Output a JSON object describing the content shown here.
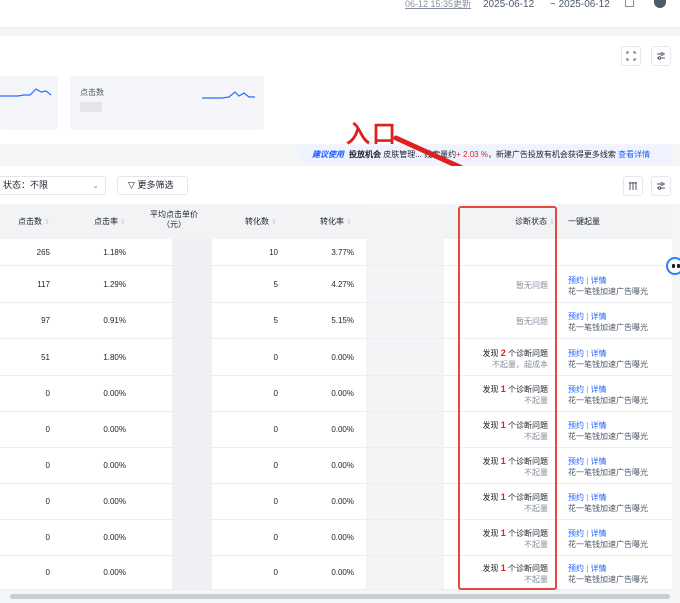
{
  "header": {
    "updated_text": "06-12 15:35更新",
    "start_date": "2025-06-12",
    "end_date": "~ 2025-06-12"
  },
  "overview": {
    "cards": [
      {
        "label": ""
      },
      {
        "label": "点击数"
      }
    ]
  },
  "annotation": {
    "text": "入口",
    "color": "#e02020"
  },
  "notice": {
    "tag": "建议使用",
    "prefix": "投放机会",
    "text": "皮肤管理... 线索量约",
    "change": "+ 2.03 %",
    "suffix": "，新建广告投放有机会获得更多线索",
    "link": "查看详情"
  },
  "filters": {
    "status_label": "状态：",
    "status_value": "不限",
    "more_label": "更多筛选"
  },
  "table": {
    "columns": {
      "clicks": "点击数",
      "ctr": "点击率",
      "cpc_line1": "平均点击单价",
      "cpc_line2": "（元）",
      "conversions": "转化数",
      "cvr": "转化率",
      "diagnosis": "诊断状态",
      "boost": "一键起量"
    },
    "rows": [
      {
        "clicks": "265",
        "ctr": "1.18%",
        "conv": "10",
        "cvr": "3.77%",
        "diag_line1": "",
        "diag_line2": "",
        "diag_num": "",
        "link1": "",
        "sep": "",
        "link2": "",
        "sub": ""
      },
      {
        "clicks": "117",
        "ctr": "1.29%",
        "conv": "5",
        "cvr": "4.27%",
        "diag_line1": "暂无问题",
        "diag_line2": "",
        "diag_num": "",
        "link1": "预约",
        "sep": "|",
        "link2": "详情",
        "sub": "花一笔钱加速广告曝光"
      },
      {
        "clicks": "97",
        "ctr": "0.91%",
        "conv": "5",
        "cvr": "5.15%",
        "diag_line1": "暂无问题",
        "diag_line2": "",
        "diag_num": "",
        "link1": "预约",
        "sep": "|",
        "link2": "详情",
        "sub": "花一笔钱加速广告曝光"
      },
      {
        "clicks": "51",
        "ctr": "1.80%",
        "conv": "0",
        "cvr": "0.00%",
        "diag_line1": "个诊断问题",
        "diag_line2": "不起量，超成本",
        "diag_num": "2",
        "link1": "预约",
        "sep": "|",
        "link2": "详情",
        "sub": "花一笔钱加速广告曝光"
      },
      {
        "clicks": "0",
        "ctr": "0.00%",
        "conv": "0",
        "cvr": "0.00%",
        "diag_line1": "个诊断问题",
        "diag_line2": "不起量",
        "diag_num": "1",
        "link1": "预约",
        "sep": "|",
        "link2": "详情",
        "sub": "花一笔钱加速广告曝光"
      },
      {
        "clicks": "0",
        "ctr": "0.00%",
        "conv": "0",
        "cvr": "0.00%",
        "diag_line1": "个诊断问题",
        "diag_line2": "不起量",
        "diag_num": "1",
        "link1": "预约",
        "sep": "|",
        "link2": "详情",
        "sub": "花一笔钱加速广告曝光"
      },
      {
        "clicks": "0",
        "ctr": "0.00%",
        "conv": "0",
        "cvr": "0.00%",
        "diag_line1": "个诊断问题",
        "diag_line2": "不起量",
        "diag_num": "1",
        "link1": "预约",
        "sep": "|",
        "link2": "详情",
        "sub": "花一笔钱加速广告曝光"
      },
      {
        "clicks": "0",
        "ctr": "0.00%",
        "conv": "0",
        "cvr": "0.00%",
        "diag_line1": "个诊断问题",
        "diag_line2": "不起量",
        "diag_num": "1",
        "link1": "预约",
        "sep": "|",
        "link2": "详情",
        "sub": "花一笔钱加速广告曝光"
      },
      {
        "clicks": "0",
        "ctr": "0.00%",
        "conv": "0",
        "cvr": "0.00%",
        "diag_line1": "个诊断问题",
        "diag_line2": "不起量",
        "diag_num": "1",
        "link1": "预约",
        "sep": "|",
        "link2": "详情",
        "sub": "花一笔钱加速广告曝光"
      },
      {
        "clicks": "0",
        "ctr": "0.00%",
        "conv": "0",
        "cvr": "0.00%",
        "diag_line1": "个诊断问题",
        "diag_line2": "不起量",
        "diag_num": "1",
        "link1": "预约",
        "sep": "|",
        "link2": "详情",
        "sub": "花一笔钱加速广告曝光"
      }
    ],
    "found_prefix": "发现"
  },
  "colors": {
    "accent": "#1f5fff",
    "highlight_box": "#e8473c",
    "up": "#e02020"
  }
}
